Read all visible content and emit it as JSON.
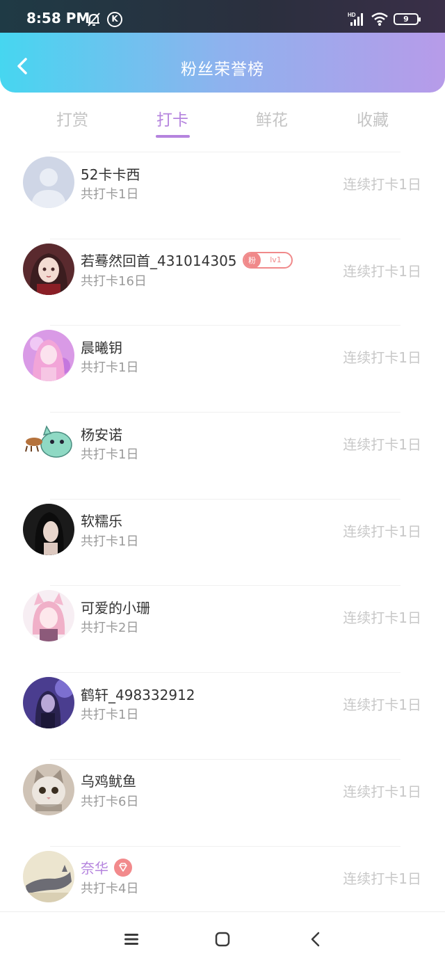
{
  "status_bar": {
    "time": "8:58 PM",
    "k_icon_label": "K",
    "battery": "9",
    "icons": [
      "bell-off-icon",
      "k-icon",
      "hd-signal-icon",
      "wifi-icon",
      "battery-icon"
    ]
  },
  "header": {
    "title": "粉丝荣誉榜",
    "back_icon": "chevron-left-icon",
    "gradient_colors": [
      "#46d6f0",
      "#b79be9"
    ]
  },
  "tabs": {
    "items": [
      {
        "label": "打赏",
        "active": false
      },
      {
        "label": "打卡",
        "active": true
      },
      {
        "label": "鲜花",
        "active": false
      },
      {
        "label": "收藏",
        "active": false
      }
    ],
    "active_color": "#b584de"
  },
  "list": [
    {
      "name": "52卡卡西",
      "total": "共打卡1日",
      "streak": "连续打卡1日",
      "avatar_icon": "default-person-icon"
    },
    {
      "name": "若蓦然回首_431014305",
      "total": "共打卡16日",
      "streak": "连续打卡1日",
      "badge": {
        "prefix": "粉",
        "level": "lv1"
      }
    },
    {
      "name": "晨曦钥",
      "total": "共打卡1日",
      "streak": "连续打卡1日"
    },
    {
      "name": "杨安诺",
      "total": "共打卡1日",
      "streak": "连续打卡1日"
    },
    {
      "name": "软糯乐",
      "total": "共打卡1日",
      "streak": "连续打卡1日"
    },
    {
      "name": "可爱的小珊",
      "total": "共打卡2日",
      "streak": "连续打卡1日"
    },
    {
      "name": "鹤轩_498332912",
      "total": "共打卡1日",
      "streak": "连续打卡1日"
    },
    {
      "name": "乌鸡鱿鱼",
      "total": "共打卡6日",
      "streak": "连续打卡1日"
    },
    {
      "name": "奈华",
      "total": "共打卡4日",
      "streak": "连续打卡1日",
      "vip_icon": "diamond-icon"
    }
  ],
  "nav_bar": {
    "icons": [
      "menu-icon",
      "home-square-icon",
      "back-triangle-icon"
    ]
  }
}
